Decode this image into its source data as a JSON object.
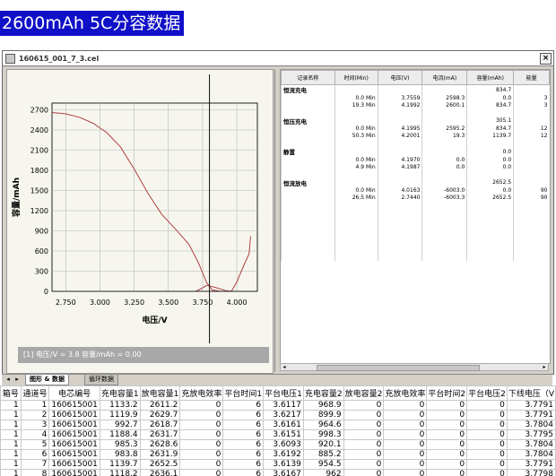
{
  "heading": "2600mAh 5C分容数据",
  "window": {
    "title": "160615_001_7_3.cel",
    "close": "×"
  },
  "chart_data": {
    "type": "line",
    "xlabel": "电压/V",
    "ylabel": "容量/mAh",
    "xlim": [
      2.65,
      4.15
    ],
    "ylim": [
      0,
      2800
    ],
    "x_ticks": [
      "2.750",
      "3.000",
      "3.250",
      "3.500",
      "3.750",
      "4.000"
    ],
    "y_ticks": [
      "0",
      "300",
      "600",
      "900",
      "1200",
      "1500",
      "1800",
      "2100",
      "2400",
      "2700"
    ],
    "cursor_x": 3.8,
    "cursor_label": "[1] 电压/V = 3.8 容量/mAh = 0.00",
    "series": [
      {
        "points": [
          [
            2.65,
            2660
          ],
          [
            2.75,
            2640
          ],
          [
            2.85,
            2590
          ],
          [
            2.95,
            2500
          ],
          [
            3.05,
            2360
          ],
          [
            3.15,
            2150
          ],
          [
            3.25,
            1820
          ],
          [
            3.35,
            1460
          ],
          [
            3.45,
            1150
          ],
          [
            3.55,
            930
          ],
          [
            3.65,
            700
          ],
          [
            3.72,
            420
          ],
          [
            3.78,
            130
          ],
          [
            3.82,
            20
          ],
          [
            3.88,
            0
          ],
          [
            3.96,
            0
          ],
          [
            4.0,
            140
          ],
          [
            4.05,
            380
          ],
          [
            4.09,
            560
          ],
          [
            4.1,
            820
          ]
        ]
      },
      {
        "points": [
          [
            3.7,
            0
          ],
          [
            3.74,
            40
          ],
          [
            3.78,
            90
          ],
          [
            3.84,
            60
          ],
          [
            3.92,
            10
          ],
          [
            3.97,
            0
          ]
        ]
      }
    ]
  },
  "grid": {
    "headers": [
      "记录名称",
      "时间(Min)",
      "电压(V)",
      "电流(mA)",
      "容量(mAh)",
      "能量"
    ],
    "rows": [
      {
        "name": "恒流充电",
        "cells": [
          "",
          "",
          "",
          "834.7",
          ""
        ]
      },
      {
        "name": "",
        "cells": [
          "0.0 Min",
          "3.7559",
          "2598.3",
          "0.0",
          "3"
        ]
      },
      {
        "name": "",
        "cells": [
          "19.3 Min",
          "4.1992",
          "2600.1",
          "834.7",
          "3"
        ]
      },
      {
        "name": "",
        "cells": [
          "",
          "",
          "",
          "",
          ""
        ]
      },
      {
        "name": "恒压充电",
        "cells": [
          "",
          "",
          "",
          "305.1",
          ""
        ]
      },
      {
        "name": "",
        "cells": [
          "0.0 Min",
          "4.1995",
          "2595.2",
          "834.7",
          "12"
        ]
      },
      {
        "name": "",
        "cells": [
          "50.3 Min",
          "4.2001",
          "19.3",
          "1139.7",
          "12"
        ]
      },
      {
        "name": "",
        "cells": [
          "",
          "",
          "",
          "",
          ""
        ]
      },
      {
        "name": "静置",
        "cells": [
          "",
          "",
          "",
          "0.0",
          ""
        ]
      },
      {
        "name": "",
        "cells": [
          "0.0 Min",
          "4.1970",
          "0.0",
          "0.0",
          ""
        ]
      },
      {
        "name": "",
        "cells": [
          "4.9 Min",
          "4.1987",
          "0.0",
          "0.0",
          ""
        ]
      },
      {
        "name": "",
        "cells": [
          "",
          "",
          "",
          "",
          ""
        ]
      },
      {
        "name": "恒流放电",
        "cells": [
          "",
          "",
          "",
          "2652.5",
          ""
        ]
      },
      {
        "name": "",
        "cells": [
          "0.0 Min",
          "4.0163",
          "-6003.0",
          "0.0",
          "90"
        ]
      },
      {
        "name": "",
        "cells": [
          "26.5 Min",
          "2.7440",
          "-6003.3",
          "2652.5",
          "90"
        ]
      }
    ]
  },
  "tabs": [
    {
      "label": "图形 & 数据",
      "active": true
    },
    {
      "label": "循环数据",
      "active": false
    }
  ],
  "bottom_table": {
    "headers": [
      "箱号",
      "通道号",
      "电芯编号",
      "充电容量1",
      "放电容量1",
      "充放电效率",
      "平台时间1",
      "平台电压1",
      "充电容量2",
      "放电容量2",
      "充放电效率",
      "平台时间2",
      "平台电压2",
      "下线电压（V"
    ],
    "rows": [
      [
        "1",
        "1",
        "160615001",
        "1133.2",
        "2611.2",
        "0",
        "6",
        "3.6117",
        "968.9",
        "0",
        "0",
        "0",
        "0",
        "3.7791"
      ],
      [
        "1",
        "2",
        "160615001",
        "1119.9",
        "2629.7",
        "0",
        "6",
        "3.6217",
        "899.9",
        "0",
        "0",
        "0",
        "0",
        "3.7791"
      ],
      [
        "1",
        "3",
        "160615001",
        "992.7",
        "2618.7",
        "0",
        "6",
        "3.6161",
        "964.6",
        "0",
        "0",
        "0",
        "0",
        "3.7804"
      ],
      [
        "1",
        "4",
        "160615001",
        "1188.4",
        "2631.7",
        "0",
        "6",
        "3.6151",
        "998.3",
        "0",
        "0",
        "0",
        "0",
        "3.7795"
      ],
      [
        "1",
        "5",
        "160615001",
        "985.3",
        "2628.6",
        "0",
        "6",
        "3.6093",
        "920.1",
        "0",
        "0",
        "0",
        "0",
        "3.7804"
      ],
      [
        "1",
        "6",
        "160615001",
        "983.8",
        "2631.9",
        "0",
        "6",
        "3.6192",
        "885.2",
        "0",
        "0",
        "0",
        "0",
        "3.7804"
      ],
      [
        "1",
        "7",
        "160615001",
        "1139.7",
        "2652.5",
        "0",
        "6",
        "3.6139",
        "954.5",
        "0",
        "0",
        "0",
        "0",
        "3.7791"
      ],
      [
        "1",
        "8",
        "160615001",
        "1118.2",
        "2636.1",
        "0",
        "6",
        "3.6167",
        "962",
        "0",
        "0",
        "0",
        "0",
        "3.7798"
      ]
    ]
  }
}
